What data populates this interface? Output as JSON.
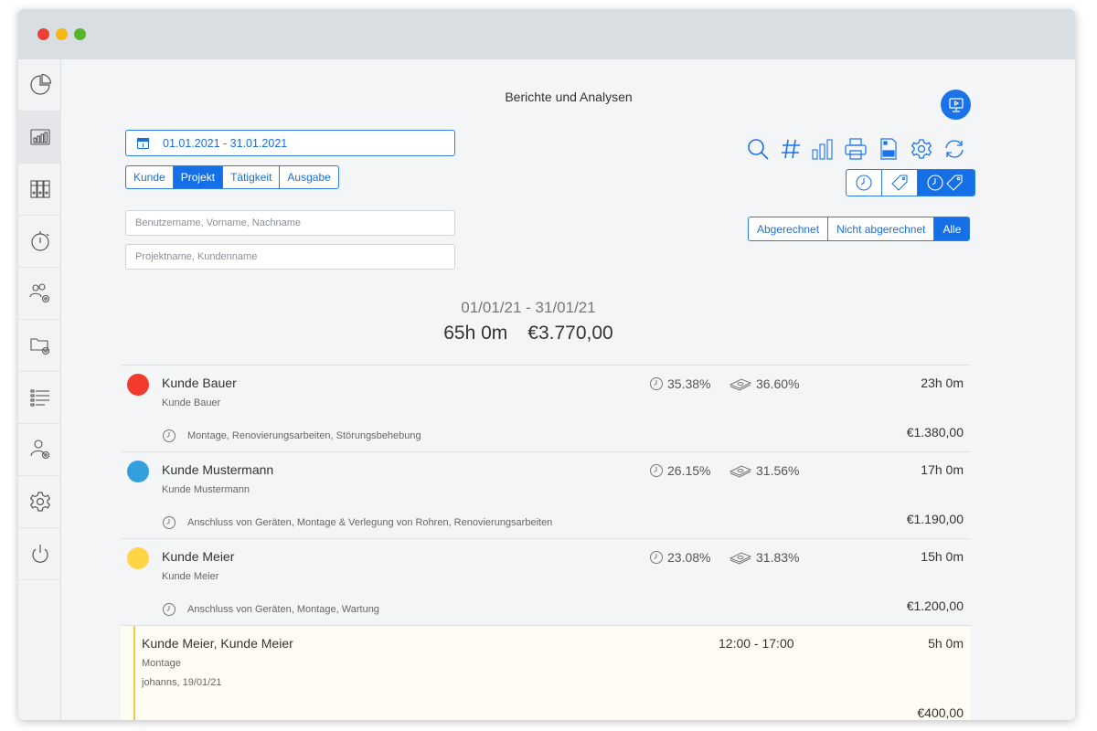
{
  "window": {
    "title": "Berichte und Analysen"
  },
  "sidebar": {
    "items": [
      {
        "icon": "pie-chart-icon",
        "active": false
      },
      {
        "icon": "bar-chart-icon",
        "active": true
      },
      {
        "icon": "binders-icon",
        "active": false
      },
      {
        "icon": "stopwatch-icon",
        "active": false
      },
      {
        "icon": "users-settings-icon",
        "active": false
      },
      {
        "icon": "folder-settings-icon",
        "active": false
      },
      {
        "icon": "list-icon",
        "active": false
      },
      {
        "icon": "user-settings-icon",
        "active": false
      },
      {
        "icon": "gear-icon",
        "active": false
      },
      {
        "icon": "power-icon",
        "active": false
      }
    ]
  },
  "filters": {
    "date_range": "01.01.2021 - 31.01.2021",
    "group_tabs": [
      "Kunde",
      "Projekt",
      "Tätigkeit",
      "Ausgabe"
    ],
    "group_selected": "Projekt",
    "user_placeholder": "Benutzername, Vorname, Nachname",
    "project_placeholder": "Projektname, Kundenname",
    "billing_tabs": [
      "Abgerechnet",
      "Nicht abgerechnet",
      "Alle"
    ],
    "billing_selected": "Alle"
  },
  "toolbar": {
    "icons": [
      "search-icon",
      "hash-icon",
      "bar-chart-icon",
      "print-icon",
      "csv-icon",
      "gear-icon",
      "refresh-icon"
    ],
    "view_modes": [
      "clock-icon",
      "tag-icon",
      "clock-tag-icon"
    ],
    "view_selected": "clock-tag-icon"
  },
  "summary": {
    "range": "01/01/21 - 31/01/21",
    "total_hours": "65h 0m",
    "total_amount": "€3.770,00"
  },
  "colors": {
    "accent": "#1570e8",
    "bauer": "#f23a2f",
    "mustermann": "#33a0de",
    "meier": "#ffd447",
    "entry_bar": "#f2cd3b"
  },
  "rows": [
    {
      "name": "Kunde Bauer",
      "sub": "Kunde Bauer",
      "time_pct": "35.38%",
      "money_pct": "36.60%",
      "hours": "23h 0m",
      "activities": "Montage, Renovierungsarbeiten, Störungsbehebung",
      "amount": "€1.380,00"
    },
    {
      "name": "Kunde Mustermann",
      "sub": "Kunde Mustermann",
      "time_pct": "26.15%",
      "money_pct": "31.56%",
      "hours": "17h 0m",
      "activities": "Anschluss von Geräten, Montage & Verlegung von Rohren, Renovierungsarbeiten",
      "amount": "€1.190,00"
    },
    {
      "name": "Kunde Meier",
      "sub": "Kunde Meier",
      "time_pct": "23.08%",
      "money_pct": "31.83%",
      "hours": "15h 0m",
      "activities": "Anschluss von Geräten, Montage, Wartung",
      "amount": "€1.200,00"
    }
  ],
  "entry": {
    "name": "Kunde Meier, Kunde Meier",
    "task": "Montage",
    "meta": "johanns, 19/01/21",
    "time": "12:00 - 17:00",
    "hours": "5h 0m",
    "amount": "€400,00"
  }
}
